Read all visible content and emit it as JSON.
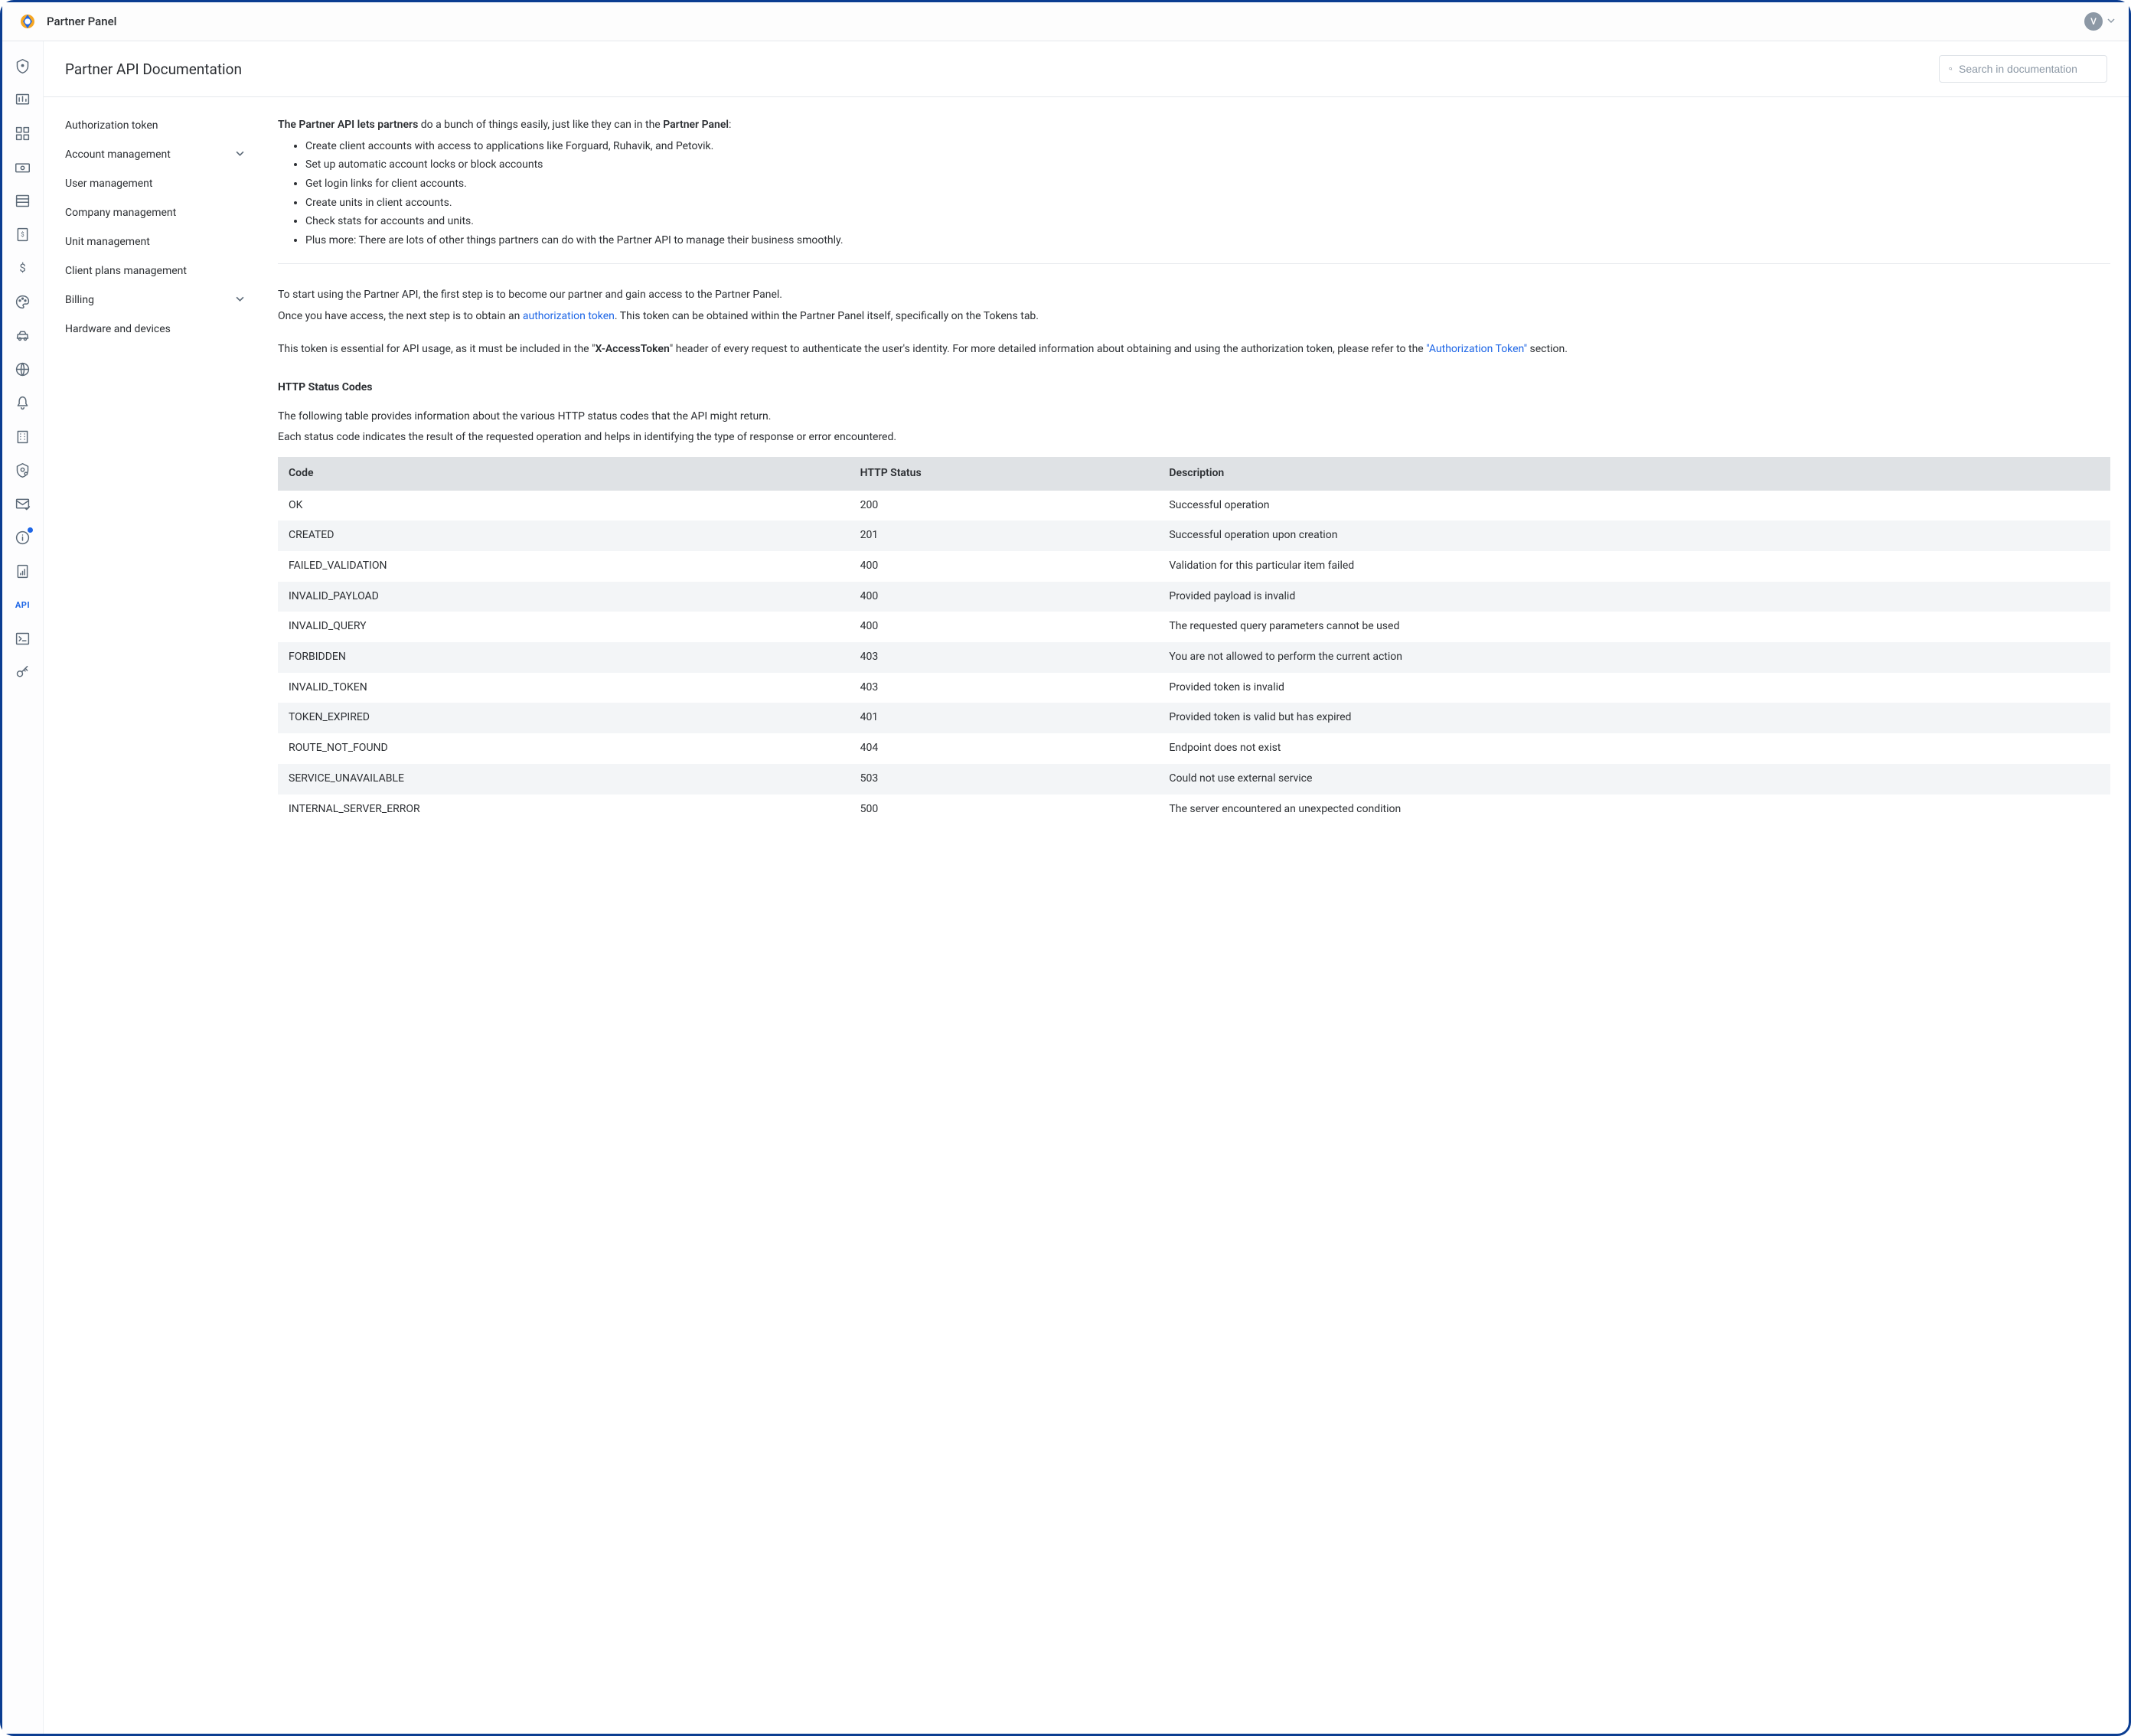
{
  "header": {
    "brand": "Partner Panel",
    "avatar_initial": "V"
  },
  "page": {
    "title": "Partner API Documentation",
    "search_placeholder": "Search in documentation"
  },
  "toc": [
    {
      "label": "Authorization token",
      "expandable": false
    },
    {
      "label": "Account management",
      "expandable": true
    },
    {
      "label": "User management",
      "expandable": false
    },
    {
      "label": "Company management",
      "expandable": false
    },
    {
      "label": "Unit management",
      "expandable": false
    },
    {
      "label": "Client plans management",
      "expandable": false
    },
    {
      "label": "Billing",
      "expandable": true
    },
    {
      "label": "Hardware and devices",
      "expandable": false
    }
  ],
  "intro": {
    "lead_bold1": "The Partner API lets partners",
    "lead_mid": " do a bunch of things easily, just like they can in the ",
    "lead_bold2": "Partner Panel",
    "lead_tail": ":",
    "bullets": [
      "Create client accounts with access to applications like Forguard, Ruhavik, and Petovik.",
      "Set up automatic account locks or block accounts",
      "Get login links for client accounts.",
      "Create units in client accounts.",
      "Check stats for accounts and units.",
      "Plus more: There are lots of other things partners can do with the Partner API to manage their business smoothly."
    ],
    "p2a": "To start using the Partner API, the first step is to become our partner and gain access to the Partner Panel.",
    "p2b_pre": "Once you have access, the next step is to obtain an ",
    "p2b_link": "authorization token",
    "p2b_post": ". This token can be obtained within the Partner Panel itself, specifically on the Tokens tab.",
    "p3_pre": "This token is essential for API usage, as it must be included in the \"",
    "p3_bold": "X-AccessToken",
    "p3_mid": "\" header of every request to authenticate the user's identity. For more detailed information about obtaining and using the authorization token, please refer to the ",
    "p3_link": "\"Authorization Token\"",
    "p3_post": " section."
  },
  "status_section": {
    "heading": "HTTP Status Codes",
    "desc1": "The following table provides information about the various HTTP status codes that the API might return.",
    "desc2": "Each status code indicates the result of the requested operation and helps in identifying the type of response or error encountered.",
    "columns": [
      "Code",
      "HTTP Status",
      "Description"
    ],
    "rows": [
      {
        "code": "OK",
        "status": "200",
        "desc": "Successful operation"
      },
      {
        "code": "CREATED",
        "status": "201",
        "desc": "Successful operation upon creation"
      },
      {
        "code": "FAILED_VALIDATION",
        "status": "400",
        "desc": "Validation for this particular item failed"
      },
      {
        "code": "INVALID_PAYLOAD",
        "status": "400",
        "desc": "Provided payload is invalid"
      },
      {
        "code": "INVALID_QUERY",
        "status": "400",
        "desc": "The requested query parameters cannot be used"
      },
      {
        "code": "FORBIDDEN",
        "status": "403",
        "desc": "You are not allowed to perform the current action"
      },
      {
        "code": "INVALID_TOKEN",
        "status": "403",
        "desc": "Provided token is invalid"
      },
      {
        "code": "TOKEN_EXPIRED",
        "status": "401",
        "desc": "Provided token is valid but has expired"
      },
      {
        "code": "ROUTE_NOT_FOUND",
        "status": "404",
        "desc": "Endpoint does not exist"
      },
      {
        "code": "SERVICE_UNAVAILABLE",
        "status": "503",
        "desc": "Could not use external service"
      },
      {
        "code": "INTERNAL_SERVER_ERROR",
        "status": "500",
        "desc": "The server encountered an unexpected condition"
      }
    ]
  },
  "iconbar": [
    {
      "name": "shield-icon",
      "active": false,
      "dot": false
    },
    {
      "name": "dashboard-icon",
      "active": false,
      "dot": false
    },
    {
      "name": "apps-icon",
      "active": false,
      "dot": false
    },
    {
      "name": "payment-icon",
      "active": false,
      "dot": false
    },
    {
      "name": "library-icon",
      "active": false,
      "dot": false
    },
    {
      "name": "invoice-icon",
      "active": false,
      "dot": false
    },
    {
      "name": "dollar-icon",
      "active": false,
      "dot": false
    },
    {
      "name": "palette-icon",
      "active": false,
      "dot": false
    },
    {
      "name": "car-icon",
      "active": false,
      "dot": false
    },
    {
      "name": "globe-icon",
      "active": false,
      "dot": false
    },
    {
      "name": "bell-icon",
      "active": false,
      "dot": false
    },
    {
      "name": "building-icon",
      "active": false,
      "dot": false
    },
    {
      "name": "shield-gear-icon",
      "active": false,
      "dot": false
    },
    {
      "name": "mail-check-icon",
      "active": false,
      "dot": false
    },
    {
      "name": "info-icon",
      "active": false,
      "dot": true
    },
    {
      "name": "report-icon",
      "active": false,
      "dot": false
    },
    {
      "name": "api-text",
      "active": true,
      "dot": false,
      "text": "API"
    },
    {
      "name": "terminal-icon",
      "active": false,
      "dot": false
    },
    {
      "name": "key-icon",
      "active": false,
      "dot": false
    }
  ]
}
